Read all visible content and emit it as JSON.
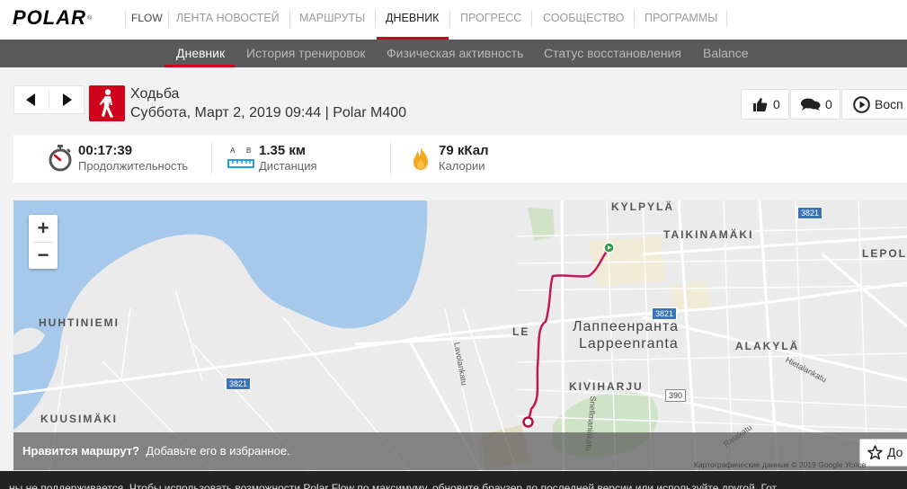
{
  "nav": {
    "logo": "POLAR",
    "flow": "FLOW",
    "items": [
      "ЛЕНТА НОВОСТЕЙ",
      "МАРШРУТЫ",
      "ДНЕВНИК",
      "ПРОГРЕСС",
      "СООБЩЕСТВО",
      "ПРОГРАММЫ"
    ],
    "active": "ДНЕВНИК"
  },
  "subnav": {
    "items": [
      "Дневник",
      "История тренировок",
      "Физическая активность",
      "Статус восстановления",
      "Balance"
    ],
    "active": "Дневник"
  },
  "session": {
    "sport": "Ходьба",
    "datetime": "Суббота, Март 2, 2019 09:44 | Polar M400",
    "likes": "0",
    "comments": "0",
    "replay_label": "Восп"
  },
  "stats": {
    "duration_value": "00:17:39",
    "duration_label": "Продолжительность",
    "distance_value": "1.35 км",
    "distance_label": "Дистанция",
    "distance_a": "A",
    "distance_b": "B",
    "calories_value": "79 кКал",
    "calories_label": "Калории"
  },
  "map": {
    "labels": {
      "kylpyla": "KYLPYLÄ",
      "taikinamaki": "TAIKINAMÄKI",
      "lepola": "LEPOL",
      "huhtiniemi": "HUHTINIEMI",
      "lappeenranta_ru": "Лаппеенранта",
      "lappeenranta": "Lappeenranta",
      "alakyla": "ALAKYLÄ",
      "kiviharju": "KIVIHARJU",
      "kuusimaki": "KUUSIMÄKI",
      "lepi": "LE",
      "hietalankatu": "Hietalankatu",
      "lavolankatu": "Lavolankatu",
      "snellmaninkatu": "Snellmaninkatu",
      "ratakatu": "Ratakatu"
    },
    "road_badges": [
      "3821",
      "3821",
      "3821",
      "390"
    ],
    "zoom_in": "+",
    "zoom_out": "−",
    "fav_question": "Нравится маршрут?",
    "fav_text": "Добавьте его в избранное.",
    "fav_button": "До",
    "credit": "Картографические данные © 2019 Google   Услов"
  },
  "cookie_strip": "...ны не поддерживается. Чтобы использовать возможности Polar Flow по максимуму, обновите браузер до последней версии или используйте другой.   Гот"
}
